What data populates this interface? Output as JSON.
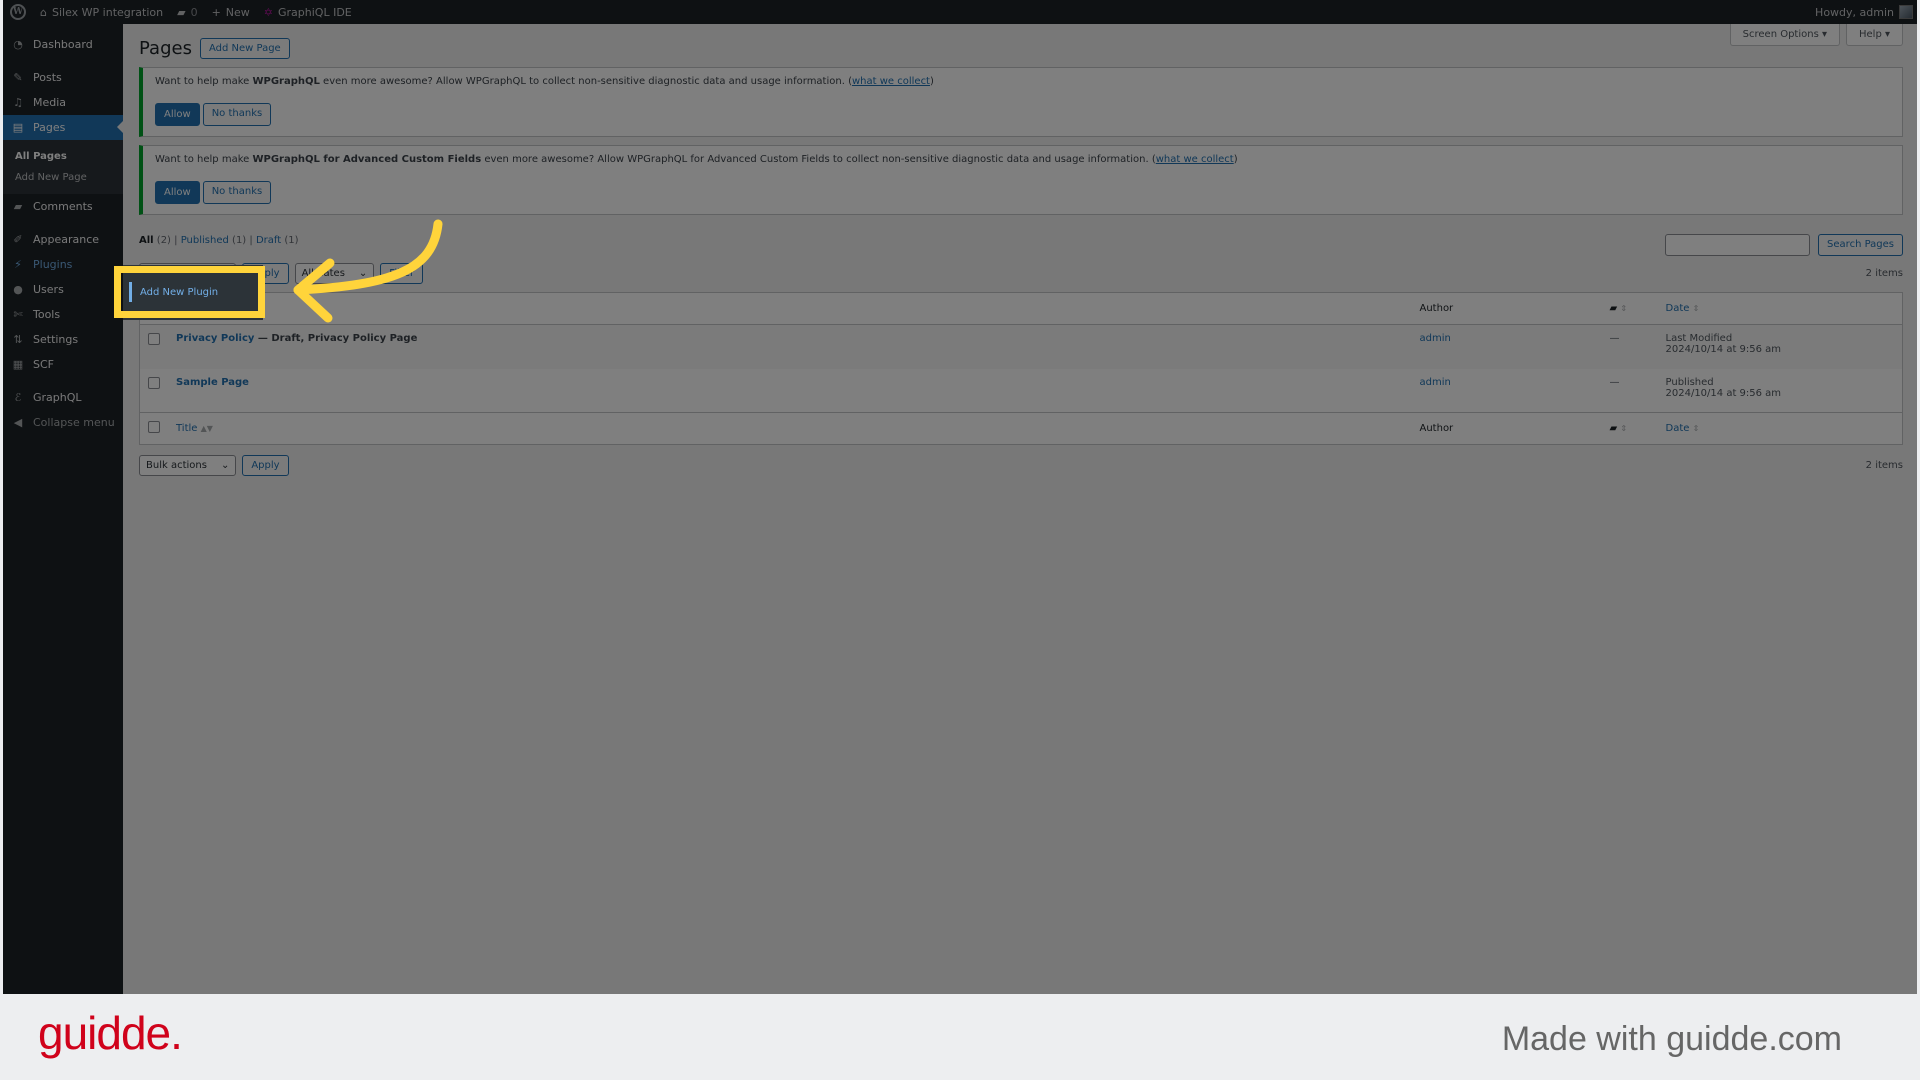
{
  "admin_bar": {
    "site_name": "Silex WP integration",
    "comments_count": "0",
    "new_label": "New",
    "graphiql_label": "GraphiQL IDE",
    "howdy": "Howdy, admin"
  },
  "sidebar": {
    "items": [
      {
        "label": "Dashboard",
        "icon": "dashboard-icon"
      },
      {
        "label": "Posts",
        "icon": "pin-icon"
      },
      {
        "label": "Media",
        "icon": "media-icon"
      },
      {
        "label": "Pages",
        "icon": "pages-icon"
      },
      {
        "label": "Comments",
        "icon": "comment-icon"
      },
      {
        "label": "Appearance",
        "icon": "brush-icon"
      },
      {
        "label": "Plugins",
        "icon": "plugin-icon"
      },
      {
        "label": "Users",
        "icon": "user-icon"
      },
      {
        "label": "Tools",
        "icon": "wrench-icon"
      },
      {
        "label": "Settings",
        "icon": "settings-icon"
      },
      {
        "label": "SCF",
        "icon": "grid-icon"
      },
      {
        "label": "GraphQL",
        "icon": "graphql-icon"
      },
      {
        "label": "Collapse menu",
        "icon": "collapse-icon"
      }
    ],
    "pages_submenu": [
      "All Pages",
      "Add New Page"
    ]
  },
  "flyout": {
    "item": "Add New Plugin"
  },
  "screen_meta": {
    "screen_options": "Screen Options ▾",
    "help": "Help ▾"
  },
  "page": {
    "title": "Pages",
    "add_new": "Add New Page"
  },
  "notices": [
    {
      "pre": "Want to help make ",
      "bold": "WPGraphQL",
      "post": " even more awesome? Allow WPGraphQL to collect non-sensitive diagnostic data and usage information. (",
      "link": "what we collect",
      "end": ")",
      "allow": "Allow",
      "deny": "No thanks"
    },
    {
      "pre": "Want to help make ",
      "bold": "WPGraphQL for Advanced Custom Fields",
      "post": " even more awesome? Allow WPGraphQL for Advanced Custom Fields to collect non-sensitive diagnostic data and usage information. (",
      "link": "what we collect",
      "end": ")",
      "allow": "Allow",
      "deny": "No thanks"
    }
  ],
  "filters": {
    "all": "All",
    "all_count": "(2)",
    "published": "Published",
    "published_count": "(1)",
    "draft": "Draft",
    "draft_count": "(1)"
  },
  "search": {
    "button": "Search Pages",
    "value": ""
  },
  "tablenav": {
    "bulk_actions": "Bulk actions",
    "apply": "Apply",
    "all_dates": "All dates",
    "filter": "Filter",
    "items_count": "2 items"
  },
  "table": {
    "columns": {
      "title": "Title",
      "author": "Author",
      "date": "Date"
    },
    "rows": [
      {
        "title": "Privacy Policy",
        "state": " — Draft, Privacy Policy Page",
        "author": "admin",
        "comments": "—",
        "date_status": "Last Modified",
        "date": "2024/10/14 at 9:56 am"
      },
      {
        "title": "Sample Page",
        "state": "",
        "author": "admin",
        "comments": "—",
        "date_status": "Published",
        "date": "2024/10/14 at 9:56 am"
      }
    ]
  },
  "footer": {
    "logo": "guidde.",
    "made_with": "Made with guidde.com"
  },
  "colors": {
    "accent": "#2271b1",
    "highlight": "#ffd43b",
    "brand": "#d0021b"
  }
}
